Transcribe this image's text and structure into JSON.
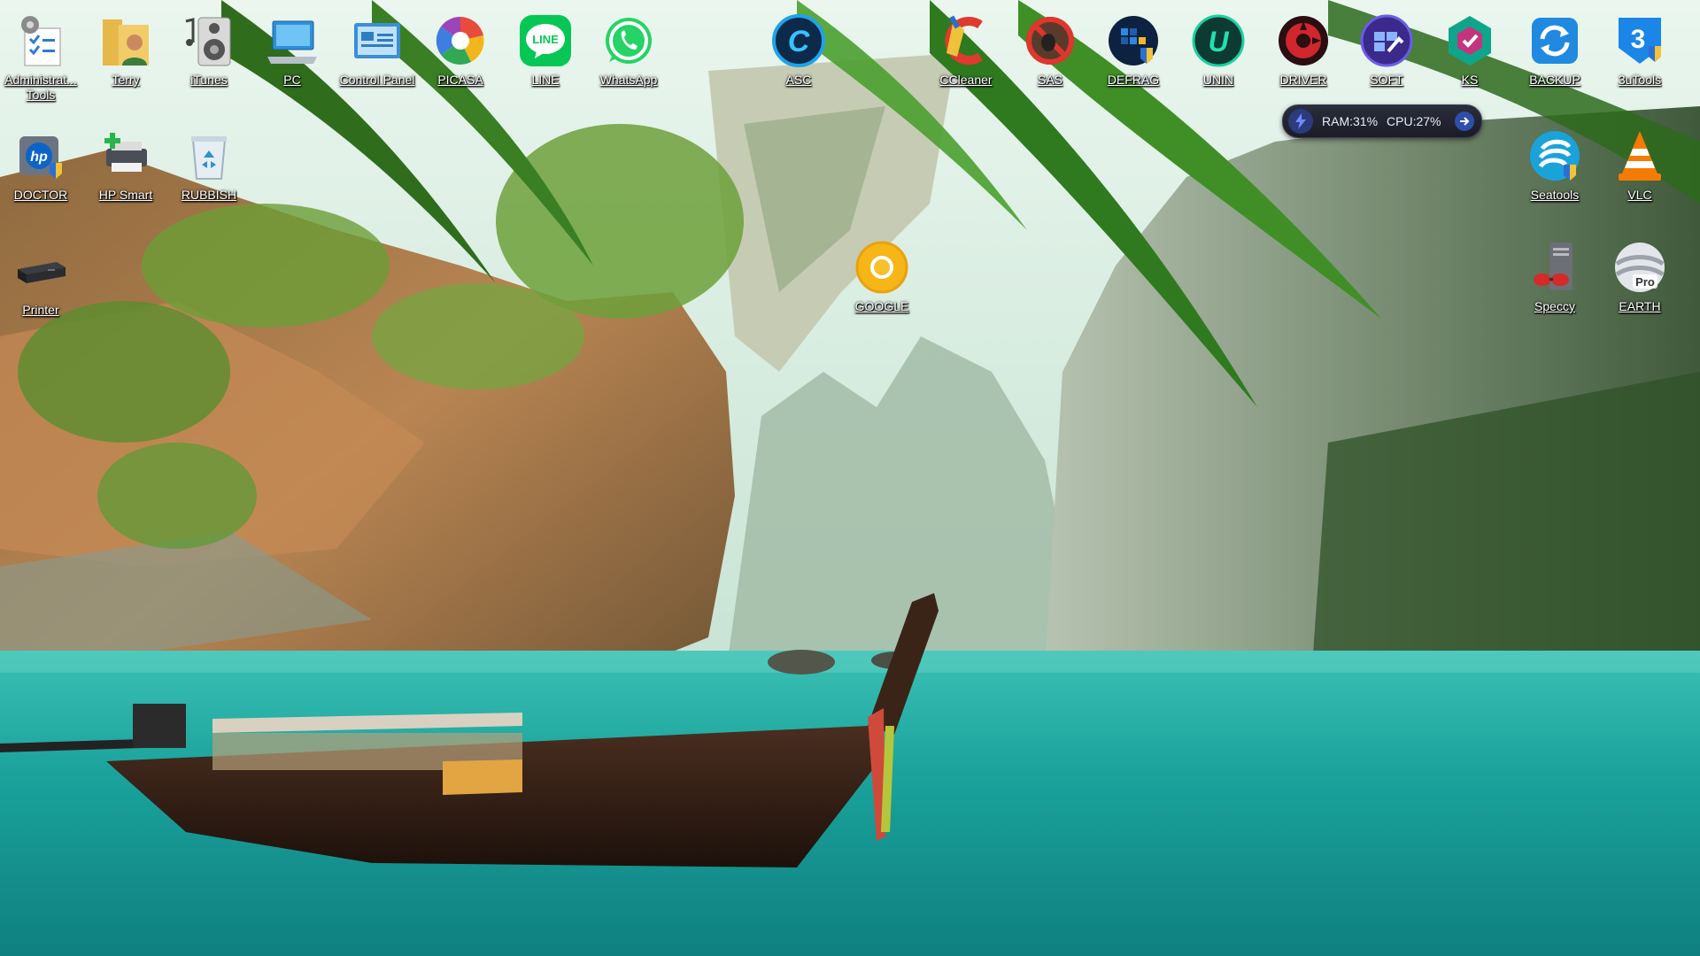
{
  "desktop": {
    "icons": [
      {
        "id": "admin",
        "label": "Administrat... Tools",
        "icon": "admin-tools-icon"
      },
      {
        "id": "terry",
        "label": "Terry",
        "icon": "user-folder-icon"
      },
      {
        "id": "itunes",
        "label": "iTunes",
        "icon": "itunes-icon"
      },
      {
        "id": "pc",
        "label": "PC",
        "icon": "computer-icon"
      },
      {
        "id": "control",
        "label": "Control Panel",
        "icon": "control-panel-icon"
      },
      {
        "id": "picasa",
        "label": "PICASA",
        "icon": "picasa-icon"
      },
      {
        "id": "line",
        "label": "LINE",
        "icon": "line-icon"
      },
      {
        "id": "whatsapp",
        "label": "WhatsApp",
        "icon": "whatsapp-icon"
      },
      {
        "id": "asc",
        "label": "ASC",
        "icon": "asc-icon"
      },
      {
        "id": "ccleaner",
        "label": "CCleaner",
        "icon": "ccleaner-icon"
      },
      {
        "id": "sas",
        "label": "SAS",
        "icon": "sas-icon"
      },
      {
        "id": "defrag",
        "label": "DEFRAG",
        "icon": "defrag-icon"
      },
      {
        "id": "unin",
        "label": "UNIN",
        "icon": "uninstaller-icon"
      },
      {
        "id": "driver",
        "label": "DRIVER",
        "icon": "driver-icon"
      },
      {
        "id": "soft",
        "label": "SOFT",
        "icon": "soft-icon"
      },
      {
        "id": "ks",
        "label": "KS",
        "icon": "ks-icon"
      },
      {
        "id": "backup",
        "label": "BACKUP",
        "icon": "backup-icon"
      },
      {
        "id": "3utools",
        "label": "3uTools",
        "icon": "3utools-icon"
      },
      {
        "id": "doctor",
        "label": "DOCTOR",
        "icon": "hp-doctor-icon"
      },
      {
        "id": "hpsmart",
        "label": "HP Smart",
        "icon": "hp-smart-icon"
      },
      {
        "id": "rubbish",
        "label": "RUBBISH",
        "icon": "recycle-bin-icon"
      },
      {
        "id": "printer",
        "label": "Printer",
        "icon": "printer-icon"
      },
      {
        "id": "google",
        "label": "GOOGLE",
        "icon": "chrome-canary-icon"
      },
      {
        "id": "seatools",
        "label": "Seatools",
        "icon": "seatools-icon"
      },
      {
        "id": "vlc",
        "label": "VLC",
        "icon": "vlc-icon"
      },
      {
        "id": "speccy",
        "label": "Speccy",
        "icon": "speccy-icon"
      },
      {
        "id": "earth",
        "label": "EARTH",
        "icon": "google-earth-pro-icon"
      }
    ]
  },
  "sysmon": {
    "ram": "RAM:31%",
    "cpu": "CPU:27%"
  },
  "earth_badge": "Pro",
  "colors": {
    "water": "#1aa39c",
    "sky": "#cfe9df",
    "foliage": "#3a7a2a",
    "label_text": "#ffffff"
  }
}
